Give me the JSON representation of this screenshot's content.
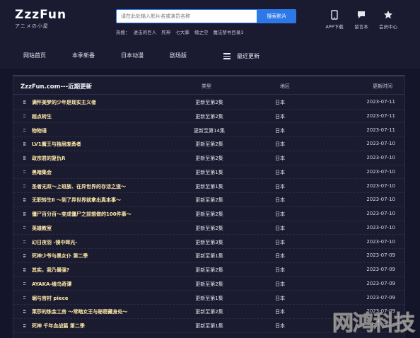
{
  "logo": {
    "title": "ZzzFun",
    "subtitle": "アニメの小屋"
  },
  "search": {
    "placeholder": "请在此处输入影片名或演员名称",
    "button": "搜索影片"
  },
  "hot": {
    "label": "热搜：",
    "items": [
      "进击的巨人",
      "死神",
      "七大罪",
      "缘之空",
      "魔法禁书目录3"
    ]
  },
  "header_icons": [
    {
      "icon": "tablet-icon",
      "label": "APP下载"
    },
    {
      "icon": "message-icon",
      "label": "留言本"
    },
    {
      "icon": "star-icon",
      "label": "会员中心"
    }
  ],
  "nav": {
    "items": [
      "网站首页",
      "本季新番",
      "日本动漫",
      "剧场版",
      "最近更新"
    ]
  },
  "table": {
    "title": "ZzzFun.com---近期更新",
    "headers": {
      "type": "类型",
      "region": "地区",
      "time": "更新时间"
    },
    "rows": [
      {
        "title": "满怀美梦的少年是现实主义者",
        "type": "更新至第2集",
        "region": "日本",
        "time": "2023-07-11"
      },
      {
        "title": "超点转生",
        "type": "更新至第2集",
        "region": "日本",
        "time": "2023-07-11"
      },
      {
        "title": "物物语",
        "type": "更新至第14集",
        "region": "日本",
        "time": "2023-07-11"
      },
      {
        "title": "LV1魔王与独居废勇者",
        "type": "更新至第2集",
        "region": "日本",
        "time": "2023-07-10"
      },
      {
        "title": "政宗君的复仇R",
        "type": "更新至第2集",
        "region": "日本",
        "time": "2023-07-10"
      },
      {
        "title": "黑暗集会",
        "type": "更新至第1集",
        "region": "日本",
        "time": "2023-07-10"
      },
      {
        "title": "圣者无双～上班族、在异世界的存活之道～",
        "type": "更新至第1集",
        "region": "日本",
        "time": "2023-07-10"
      },
      {
        "title": "无职转生Ⅱ ～到了异世界就拿出真本事～",
        "type": "更新至第2集",
        "region": "日本",
        "time": "2023-07-10"
      },
      {
        "title": "僵尸百分百～变成僵尸之前想做的100件事～",
        "type": "更新至第2集",
        "region": "日本",
        "time": "2023-07-10"
      },
      {
        "title": "英雄教室",
        "type": "更新至第2集",
        "region": "日本",
        "time": "2023-07-10"
      },
      {
        "title": "幻日夜羽 -镜中晖光-",
        "type": "更新至第3集",
        "region": "日本",
        "time": "2023-07-10"
      },
      {
        "title": "死神少爷与黑女仆 第二季",
        "type": "更新至第1集",
        "region": "日本",
        "time": "2023-07-09"
      },
      {
        "title": "其实，我乃最强?",
        "type": "更新至第2集",
        "region": "日本",
        "time": "2023-07-09"
      },
      {
        "title": "AYAKA-绫乌奇谭",
        "type": "更新至第2集",
        "region": "日本",
        "time": "2023-07-09"
      },
      {
        "title": "堀与宫村 piece",
        "type": "更新至第1集",
        "region": "日本",
        "time": "2023-07-09"
      },
      {
        "title": "莱莎的炼金工房 ～常暗女王与秘密藏身处～",
        "type": "更新至第2集",
        "region": "日本",
        "time": "2023-07-09"
      },
      {
        "title": "死神 千年血战篇 第二季",
        "type": "更新至第1集",
        "region": "日本",
        "time": "2023-07-09"
      }
    ]
  },
  "watermark": "网鸿科技"
}
